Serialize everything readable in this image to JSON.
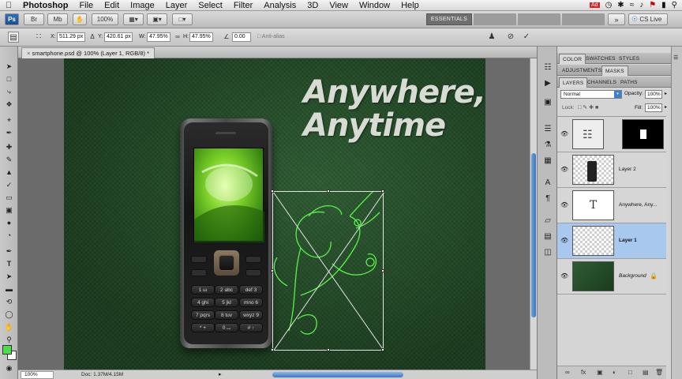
{
  "menubar": {
    "items": [
      "Photoshop",
      "File",
      "Edit",
      "Image",
      "Layer",
      "Select",
      "Filter",
      "Analysis",
      "3D",
      "View",
      "Window",
      "Help"
    ]
  },
  "appbar": {
    "zoom": "100%",
    "workspaces": [
      "ESSENTIALS"
    ],
    "cslive": "CS Live"
  },
  "options": {
    "x_label": "X:",
    "x_value": "511.29 px",
    "y_label": "Y:",
    "y_value": "420.61 px",
    "w_label": "W:",
    "w_value": "47.95%",
    "h_label": "H:",
    "h_value": "47.95%",
    "angle_value": "0.00",
    "antialias_label": "Anti-alias"
  },
  "document": {
    "tab_title": "smartphone.psd @ 100% (Layer 1, RGB/8) *",
    "headline_line1": "Anywhere,",
    "headline_line2": "Anytime"
  },
  "phone_keys": [
    [
      "1 ω",
      "2 abc",
      "def 3"
    ],
    [
      "4 ghi",
      "5 jkl",
      "mno 6"
    ],
    [
      "7 pqrs",
      "8 tuv",
      "wxyz 9"
    ],
    [
      "* +",
      "0 ⌴",
      "# ↑"
    ]
  ],
  "status": {
    "zoom": "100%",
    "doc": "Doc: 1.37M/4.15M"
  },
  "panels": {
    "top_tabs": [
      "COLOR",
      "SWATCHES",
      "STYLES"
    ],
    "mid_tabs": [
      "ADJUSTMENTS",
      "MASKS"
    ],
    "layer_tabs": [
      "LAYERS",
      "CHANNELS",
      "PATHS"
    ],
    "blend_mode": "Normal",
    "opacity_label": "Opacity:",
    "opacity_value": "100%",
    "lock_label": "Lock:",
    "fill_label": "Fill:",
    "fill_value": "100%",
    "layers": [
      {
        "name": "",
        "selected": false
      },
      {
        "name": "Layer 2",
        "selected": false
      },
      {
        "name": "Anywhere, Any...",
        "selected": false
      },
      {
        "name": "Layer 1",
        "selected": true
      },
      {
        "name": "Background",
        "selected": false
      }
    ],
    "text_layer_glyph": "T"
  },
  "colors": {
    "foreground": "#4ddc4a",
    "background": "#ffffff",
    "accent": "#3e76c2"
  }
}
